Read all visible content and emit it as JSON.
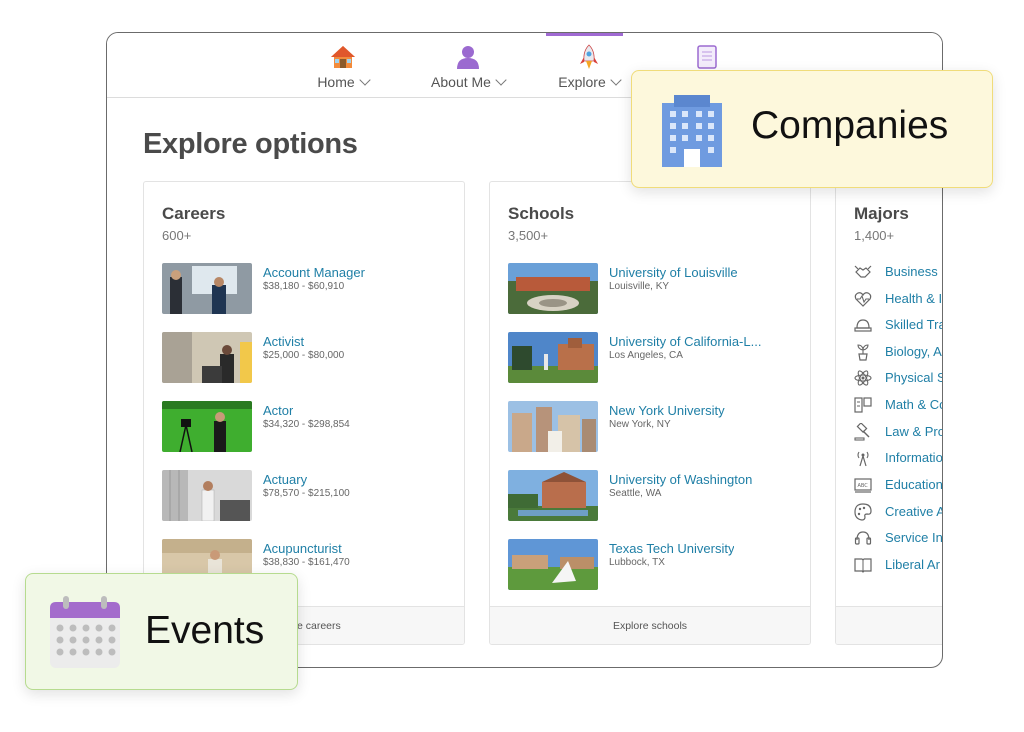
{
  "nav": {
    "items": [
      {
        "label": "Home",
        "icon": "house-icon"
      },
      {
        "label": "About Me",
        "icon": "person-icon"
      },
      {
        "label": "Explore",
        "icon": "rocket-icon"
      },
      {
        "label": "",
        "icon": "notepad-icon"
      }
    ],
    "active": "Explore",
    "accent": "#a06ad3"
  },
  "page": {
    "title": "Explore options"
  },
  "careers": {
    "title": "Careers",
    "count": "600+",
    "items": [
      {
        "name": "Account Manager",
        "sub": "$38,180 - $60,910"
      },
      {
        "name": "Activist",
        "sub": "$25,000 - $80,000"
      },
      {
        "name": "Actor",
        "sub": "$34,320 - $298,854"
      },
      {
        "name": "Actuary",
        "sub": "$78,570 - $215,100"
      },
      {
        "name": "Acupuncturist",
        "sub": "$38,830 - $161,470"
      }
    ],
    "footer": "Explore careers"
  },
  "schools": {
    "title": "Schools",
    "count": "3,500+",
    "items": [
      {
        "name": "University of Louisville",
        "sub": "Louisville, KY"
      },
      {
        "name": "University of California-L...",
        "sub": "Los Angeles, CA"
      },
      {
        "name": "New York University",
        "sub": "New York, NY"
      },
      {
        "name": "University of Washington",
        "sub": "Seattle, WA"
      },
      {
        "name": "Texas Tech University",
        "sub": "Lubbock, TX"
      }
    ],
    "footer": "Explore schools"
  },
  "majors": {
    "title": "Majors",
    "count": "1,400+",
    "items": [
      {
        "name": "Business",
        "icon": "handshake-icon"
      },
      {
        "name": "Health & I",
        "icon": "heartbeat-icon"
      },
      {
        "name": "Skilled Tra",
        "icon": "hardhat-icon"
      },
      {
        "name": "Biology, A",
        "icon": "plant-icon"
      },
      {
        "name": "Physical S",
        "icon": "atom-icon"
      },
      {
        "name": "Math & Co",
        "icon": "calculator-icon"
      },
      {
        "name": "Law & Pro",
        "icon": "gavel-icon"
      },
      {
        "name": "Informatio",
        "icon": "antenna-icon"
      },
      {
        "name": "Education",
        "icon": "chalkboard-icon"
      },
      {
        "name": "Creative A",
        "icon": "palette-icon"
      },
      {
        "name": "Service In",
        "icon": "headset-icon"
      },
      {
        "name": "Liberal Ar",
        "icon": "book-icon"
      }
    ]
  },
  "callouts": {
    "companies": {
      "label": "Companies",
      "icon": "building-icon",
      "bg": "#fdf8dc",
      "border": "#f0dc7a"
    },
    "events": {
      "label": "Events",
      "icon": "calendar-icon",
      "bg": "#f1f8e6",
      "border": "#b6db8f"
    }
  },
  "colors": {
    "link": "#1f7fa6",
    "title": "#4a4a4a"
  }
}
